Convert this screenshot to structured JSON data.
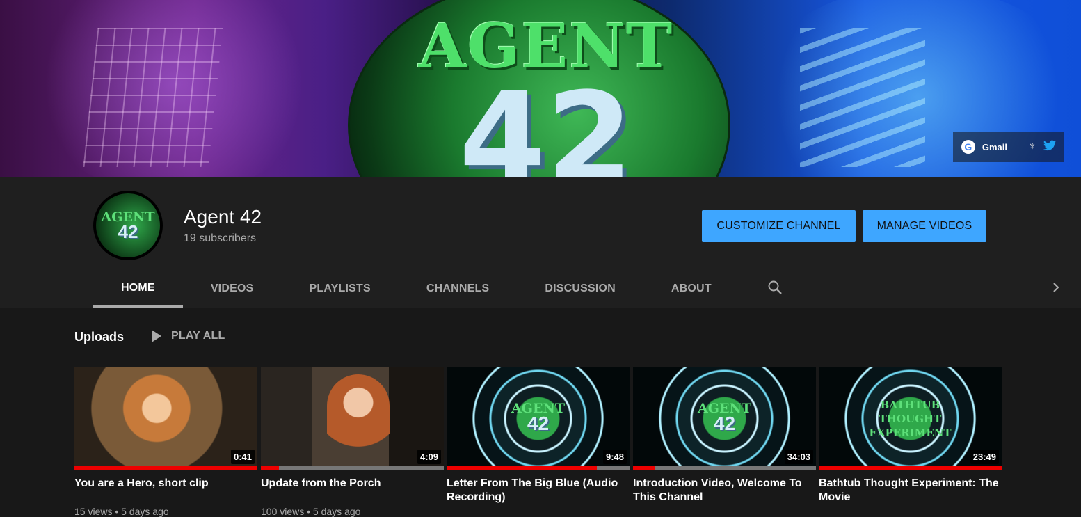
{
  "banner": {
    "logo_line1": "AGENT",
    "logo_line2": "42",
    "links": {
      "gmail_label": "Gmail"
    }
  },
  "channel": {
    "avatar_line1": "AGENT",
    "avatar_line2": "42",
    "name": "Agent 42",
    "subscribers": "19 subscribers",
    "customize_label": "CUSTOMIZE CHANNEL",
    "manage_label": "MANAGE VIDEOS"
  },
  "tabs": [
    {
      "label": "HOME",
      "active": true
    },
    {
      "label": "VIDEOS"
    },
    {
      "label": "PLAYLISTS"
    },
    {
      "label": "CHANNELS"
    },
    {
      "label": "DISCUSSION"
    },
    {
      "label": "ABOUT"
    }
  ],
  "uploads": {
    "title": "Uploads",
    "play_all": "PLAY ALL",
    "videos": [
      {
        "title": "You are a Hero, short clip",
        "duration": "0:41",
        "meta": "15 views • 5 days ago",
        "progress": 1.0
      },
      {
        "title": "Update from the Porch",
        "duration": "4:09",
        "meta": "100 views • 5 days ago",
        "progress": 0.1
      },
      {
        "title": "Letter From The Big Blue (Audio Recording)",
        "duration": "9:48",
        "meta": "",
        "progress": 0.82,
        "logo_line1": "AGENT",
        "logo_line2": "42"
      },
      {
        "title": "Introduction Video, Welcome To This Channel",
        "duration": "34:03",
        "meta": "",
        "progress": 0.12,
        "logo_line1": "AGENT",
        "logo_line2": "42"
      },
      {
        "title": "Bathtub Thought Experiment: The Movie",
        "duration": "23:49",
        "meta": "",
        "progress": 1.0,
        "logo_lines": [
          "BATHTUB",
          "THOUGHT",
          "EXPERIMENT"
        ]
      }
    ]
  },
  "colors": {
    "accent": "#3ea6ff",
    "progress": "#e00000",
    "background": "#181818",
    "header": "#1f1f1f"
  }
}
